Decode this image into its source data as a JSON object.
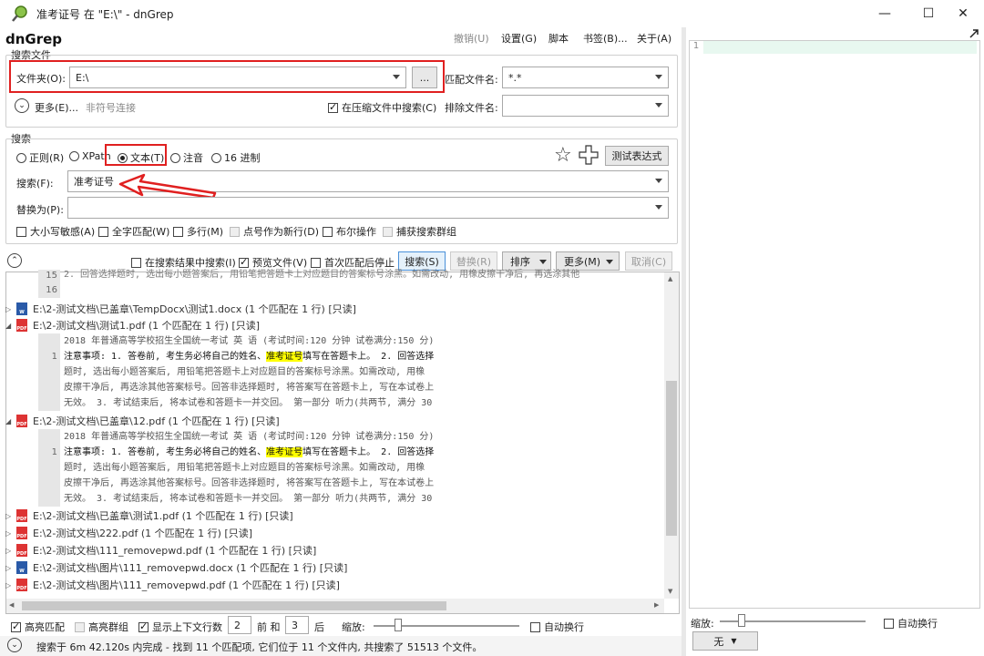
{
  "window": {
    "title": "准考证号 在 \"E:\\\" - dnGrep",
    "app_name": "dnGrep",
    "minimize": "—",
    "maximize": "☐",
    "close": "✕"
  },
  "menu": {
    "undo": "撤销(U)",
    "settings": "设置(G)",
    "script": "脚本",
    "bookmarks": "书签(B)...",
    "about": "关于(A)"
  },
  "search_files": {
    "group_label": "搜索文件",
    "folder_label": "文件夹(O):",
    "folder_value": "E:\\",
    "browse": "...",
    "match_files_label": "匹配文件名:",
    "match_files_value": "*.*",
    "more_label": "更多(E)...",
    "more_hint": "非符号连接",
    "search_archives": "在压缩文件中搜索(C)",
    "exclude_label": "排除文件名:",
    "exclude_value": ""
  },
  "search": {
    "group_label": "搜索",
    "modes": [
      "正则(R)",
      "XPath",
      "文本(T)",
      "注音",
      "16 进制"
    ],
    "test_expression": "测试表达式",
    "search_label": "搜索(F):",
    "search_value": "准考证号",
    "replace_label": "替换为(P):",
    "replace_value": "",
    "options": [
      "大小写敏感(A)",
      "全字匹配(W)",
      "多行(M)",
      "点号作为新行(D)",
      "布尔操作",
      "捕获搜索群组"
    ]
  },
  "toolbar": {
    "search_in_results": "在搜索结果中搜索(I)",
    "preview_file": "预览文件(V)",
    "stop_after_first": "首次匹配后停止",
    "search_btn": "搜索(S)",
    "replace_btn": "替换(R)",
    "sort_btn": "排序",
    "more_btn": "更多(M)",
    "cancel_btn": "取消(C)"
  },
  "results": {
    "top_ln": [
      "15",
      "16"
    ],
    "top_ctx": "2. 回答选择题时, 选出每小题答案后, 用铅笔把答题卡上对应题目的答案标号涂黑。如需改动, 用橡皮擦干净后, 再选涂其他",
    "files": [
      {
        "icon": "doc",
        "name": "E:\\2-测试文档\\已盖章\\TempDocx\\测试1.docx (1 个匹配在 1 行) [只读]"
      },
      {
        "icon": "pdf",
        "name": "E:\\2-测试文档\\测试1.pdf (1 个匹配在 1 行) [只读]"
      },
      {
        "icon": "pdf",
        "name": "E:\\2-测试文档\\已盖章\\12.pdf (1 个匹配在 1 行) [只读]"
      },
      {
        "icon": "pdf",
        "name": "E:\\2-测试文档\\已盖章\\测试1.pdf (1 个匹配在 1 行) [只读]"
      },
      {
        "icon": "pdf",
        "name": "E:\\2-测试文档\\222.pdf (1 个匹配在 1 行) [只读]"
      },
      {
        "icon": "pdf",
        "name": "E:\\2-测试文档\\111_removepwd.pdf (1 个匹配在 1 行) [只读]"
      },
      {
        "icon": "doc",
        "name": "E:\\2-测试文档\\图片\\111_removepwd.docx (1 个匹配在 1 行) [只读]"
      },
      {
        "icon": "pdf",
        "name": "E:\\2-测试文档\\图片\\111_removepwd.pdf (1 个匹配在 1 行) [只读]"
      }
    ],
    "context": {
      "line0": "2018 年普通高等学校招生全国统一考试 英 语 (考试时间:120 分钟 试卷满分:150 分)",
      "line1_pre": "注意事项: 1. 答卷前, 考生务必将自己的姓名、",
      "line1_hl": "准考证号",
      "line1_post": "填写在答题卡上。 2. 回答选择",
      "line2": "题时, 选出每小题答案后, 用铅笔把答题卡上对应题目的答案标号涂黑。如需改动, 用橡",
      "line3": "皮擦干净后, 再选涂其他答案标号。回答非选择题时, 将答案写在答题卡上, 写在本试卷上",
      "line4": "无效。 3. 考试结束后, 将本试卷和答题卡一并交回。 第一部分 听力(共两节, 满分 30",
      "ln": "1"
    }
  },
  "bottom": {
    "highlight": "高亮匹配",
    "highlight_groups": "高亮群组",
    "show_context": "显示上下文行数",
    "before_val": "2",
    "before_label": "前 和",
    "after_val": "3",
    "after_label": "后",
    "zoom_label": "缩放:",
    "word_wrap": "自动换行"
  },
  "status": {
    "text": "搜索于 6m 42.120s 内完成 - 找到 11 个匹配项, 它们位于 11 个文件内, 共搜索了 51513 个文件。"
  },
  "preview": {
    "line_no": "1",
    "zoom_label": "缩放:",
    "word_wrap": "自动换行",
    "encoding": "无"
  }
}
